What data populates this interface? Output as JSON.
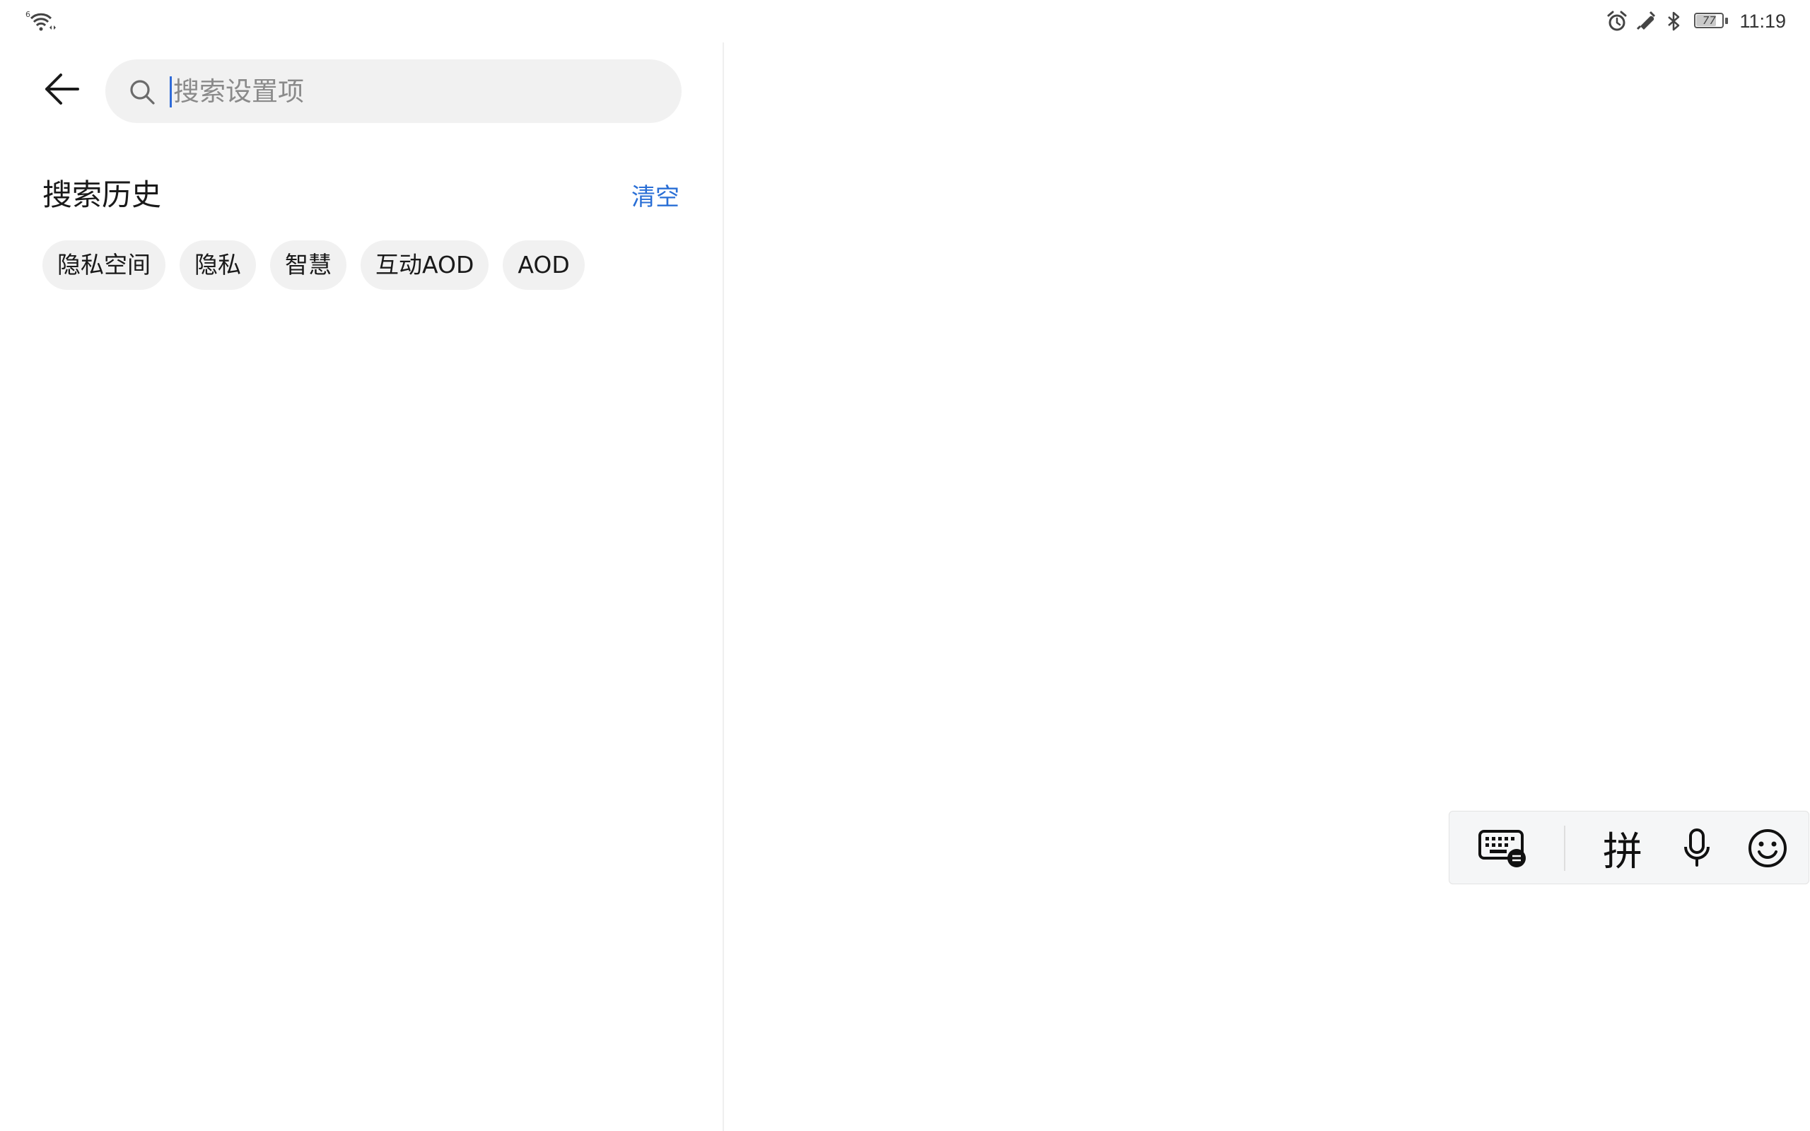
{
  "status_bar": {
    "signal_badge": "6",
    "battery_level": "77",
    "time": "11:19",
    "icons": [
      "wifi-icon",
      "alarm-icon",
      "no-disturb-icon",
      "bluetooth-icon",
      "battery-icon"
    ]
  },
  "search": {
    "placeholder": "搜索设置项",
    "value": ""
  },
  "history": {
    "title": "搜索历史",
    "clear_label": "清空",
    "chips": [
      "隐私空间",
      "隐私",
      "智慧",
      "互动AOD",
      "AOD"
    ]
  },
  "keyboard_toolbar": {
    "pinyin_label": "拼",
    "icons": [
      "keyboard-switch-icon",
      "microphone-icon",
      "emoji-icon"
    ]
  },
  "colors": {
    "accent": "#2a6fd6",
    "chip_bg": "#f1f1f1",
    "search_bg": "#f1f1f1"
  }
}
